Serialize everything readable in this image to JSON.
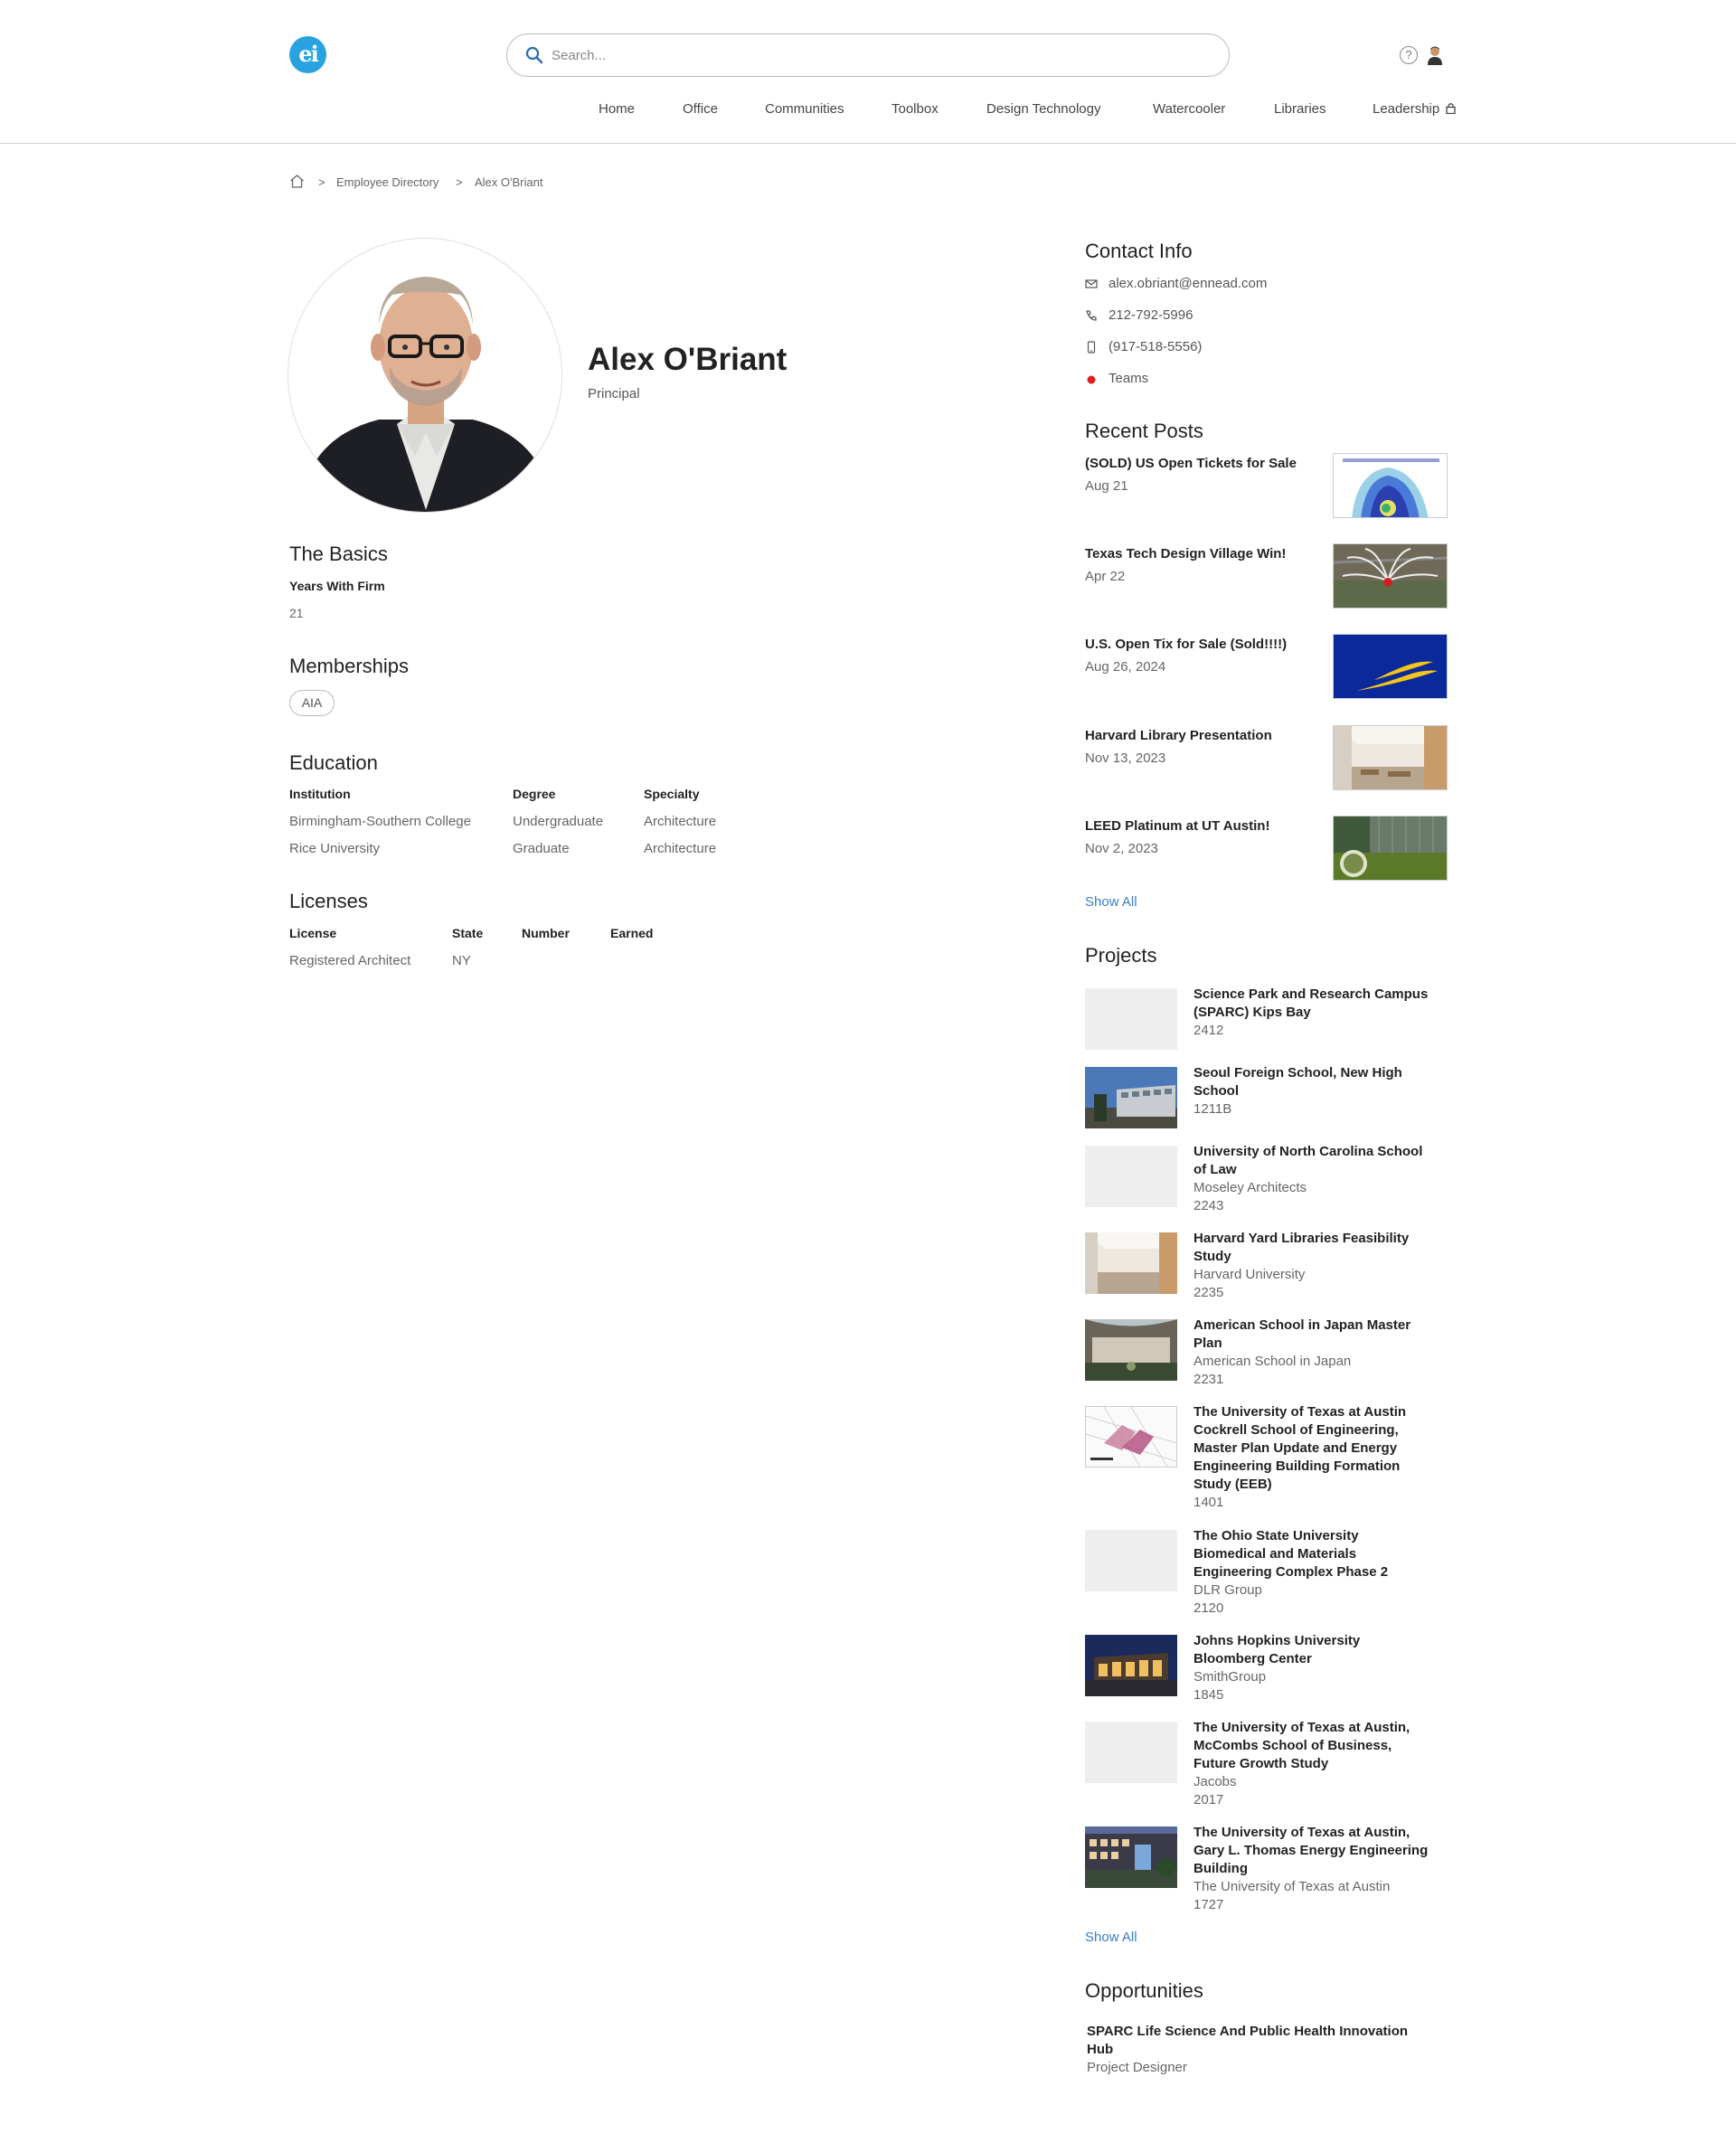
{
  "header": {
    "logo_text": "ei",
    "search_placeholder": "Search...",
    "help_icon": "?",
    "nav": [
      "Home",
      "Office",
      "Communities",
      "Toolbox",
      "Design Technology",
      "Watercooler",
      "Libraries",
      "Leadership"
    ]
  },
  "breadcrumb": {
    "sep": ">",
    "items": [
      "Employee Directory",
      "Alex O'Briant"
    ]
  },
  "profile": {
    "name": "Alex O'Briant",
    "title": "Principal"
  },
  "basics": {
    "heading": "The Basics",
    "label": "Years With Firm",
    "value": "21"
  },
  "memberships": {
    "heading": "Memberships",
    "items": [
      "AIA"
    ]
  },
  "education": {
    "heading": "Education",
    "columns": [
      "Institution",
      "Degree",
      "Specialty"
    ],
    "rows": [
      [
        "Birmingham-Southern College",
        "Undergraduate",
        "Architecture"
      ],
      [
        "Rice University",
        "Graduate",
        "Architecture"
      ]
    ]
  },
  "licenses": {
    "heading": "Licenses",
    "columns": [
      "License",
      "State",
      "Number",
      "Earned"
    ],
    "rows": [
      [
        "Registered Architect",
        "NY",
        "",
        ""
      ]
    ]
  },
  "contact": {
    "heading": "Contact Info",
    "email": "alex.obriant@ennead.com",
    "phone": "212-792-5996",
    "mobile": "(917-518-5556)",
    "teams": "Teams",
    "teams_status_color": "#e02020"
  },
  "posts": {
    "heading": "Recent Posts",
    "items": [
      {
        "title": "(SOLD) US Open Tickets for Sale",
        "date": "Aug 21"
      },
      {
        "title": "Texas Tech Design Village Win!",
        "date": "Apr 22"
      },
      {
        "title": "U.S. Open Tix for Sale (Sold!!!!)",
        "date": "Aug 26, 2024"
      },
      {
        "title": "Harvard Library Presentation",
        "date": "Nov 13, 2023"
      },
      {
        "title": "LEED Platinum at UT Austin!",
        "date": "Nov 2, 2023"
      }
    ],
    "show_all": "Show All"
  },
  "projects": {
    "heading": "Projects",
    "items": [
      {
        "title": "Science Park and Research Campus (SPARC) Kips Bay",
        "client": "",
        "number": "2412"
      },
      {
        "title": "Seoul Foreign School, New High School",
        "client": "",
        "number": "1211B"
      },
      {
        "title": "University of North Carolina School of Law",
        "client": "Moseley Architects",
        "number": "2243"
      },
      {
        "title": "Harvard Yard Libraries Feasibility Study",
        "client": "Harvard University",
        "number": "2235"
      },
      {
        "title": "American School in Japan Master Plan",
        "client": "American School in Japan",
        "number": "2231"
      },
      {
        "title": "The University of Texas at Austin Cockrell School of Engineering, Master Plan Update and Energy Engineering Building Formation Study (EEB)",
        "client": "",
        "number": "1401"
      },
      {
        "title": "The Ohio State University Biomedical and Materials Engineering Complex Phase 2",
        "client": "DLR Group",
        "number": "2120"
      },
      {
        "title": "Johns Hopkins University Bloomberg Center",
        "client": "SmithGroup",
        "number": "1845"
      },
      {
        "title": "The University of Texas at Austin, McCombs School of Business, Future Growth Study",
        "client": "Jacobs",
        "number": "2017"
      },
      {
        "title": "The University of Texas at Austin, Gary L. Thomas Energy Engineering Building",
        "client": "The University of Texas at Austin",
        "number": "1727"
      }
    ],
    "show_all": "Show All"
  },
  "opportunities": {
    "heading": "Opportunities",
    "items": [
      {
        "title": "SPARC Life Science And Public Health Innovation Hub",
        "role": "Project Designer"
      }
    ]
  }
}
